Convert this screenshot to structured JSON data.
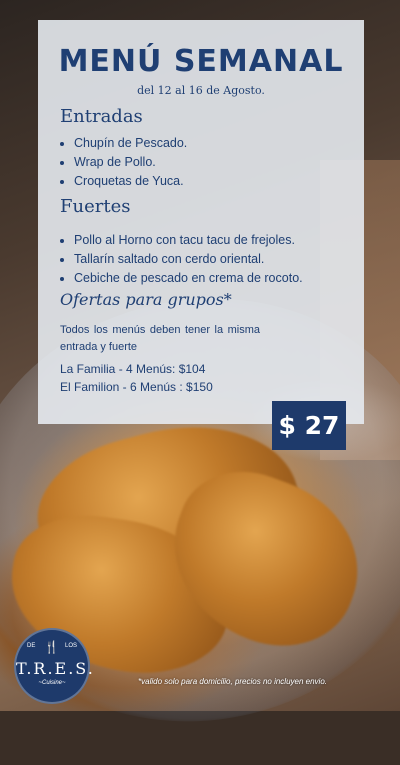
{
  "header": {
    "title": "MENÚ SEMANAL",
    "dates": "del 12 al 16 de Agosto."
  },
  "sections": {
    "entradas": {
      "title": "Entradas",
      "items": [
        "Chupín de Pescado.",
        "Wrap de Pollo.",
        "Croquetas de Yuca."
      ]
    },
    "fuertes": {
      "title": "Fuertes",
      "items": [
        "Pollo al Horno con tacu tacu de frejoles.",
        "Tallarín saltado con cerdo oriental.",
        "Cebiche de pescado en crema de rocoto."
      ]
    },
    "ofertas": {
      "title": "Ofertas para grupos*",
      "note": "Todos los menús deben tener la misma entrada y fuerte",
      "offers": [
        "La Familia - 4 Menús: $104",
        "El Familion - 6 Menús : $150"
      ]
    }
  },
  "price": "$ 27",
  "logo": {
    "de": "DE",
    "los": "LOS",
    "name": "T.R.E.S.",
    "signature": "~Cuisine~",
    "icon": "utensils-icon"
  },
  "disclaimer": "*valido solo para domicilio, precios no incluyen envio.",
  "colors": {
    "primary": "#1f3f73",
    "price_bg": "#1e3a6b",
    "panel_bg": "#e6eaf0"
  }
}
